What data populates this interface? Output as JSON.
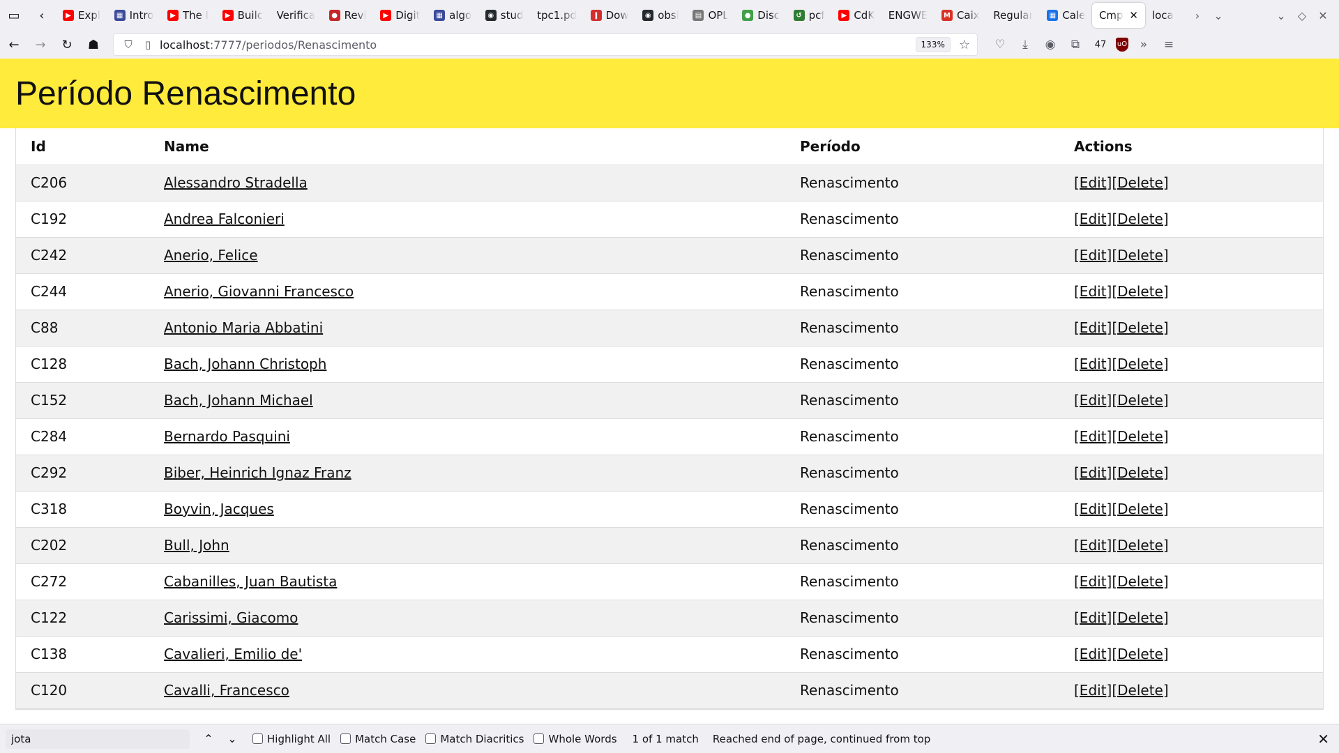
{
  "browser": {
    "tabs": [
      {
        "label": "Expl",
        "fav": "▶",
        "favcolor": "#ff0000"
      },
      {
        "label": "Intro",
        "fav": "▦",
        "favcolor": "#3c4a9a"
      },
      {
        "label": "The I",
        "fav": "▶",
        "favcolor": "#ff0000"
      },
      {
        "label": "Builc",
        "fav": "▶",
        "favcolor": "#ff0000"
      },
      {
        "label": "Verifica",
        "fav": "",
        "favcolor": "transparent"
      },
      {
        "label": "Revi",
        "fav": "●",
        "favcolor": "#c62828"
      },
      {
        "label": "Digit",
        "fav": "▶",
        "favcolor": "#ff0000"
      },
      {
        "label": "algo",
        "fav": "▦",
        "favcolor": "#3c4a9a"
      },
      {
        "label": "stud",
        "fav": "◉",
        "favcolor": "#24292f"
      },
      {
        "label": "tpc1.pd",
        "fav": "",
        "favcolor": "transparent"
      },
      {
        "label": "Dow",
        "fav": "‖",
        "favcolor": "#d32f2f"
      },
      {
        "label": "obsi",
        "fav": "◉",
        "favcolor": "#24292f"
      },
      {
        "label": "OPL",
        "fav": "▤",
        "favcolor": "#777777"
      },
      {
        "label": "Disc",
        "fav": "●",
        "favcolor": "#43a047"
      },
      {
        "label": "pcf",
        "fav": "↺",
        "favcolor": "#2e7d32"
      },
      {
        "label": "CdK",
        "fav": "▶",
        "favcolor": "#ff0000"
      },
      {
        "label": "ENGWE",
        "fav": "",
        "favcolor": "transparent"
      },
      {
        "label": "Caix",
        "fav": "M",
        "favcolor": "#d93025"
      },
      {
        "label": "Regular",
        "fav": "",
        "favcolor": "transparent"
      },
      {
        "label": "Cale",
        "fav": "▦",
        "favcolor": "#1a73e8"
      },
      {
        "label": "Cmpc",
        "fav": "",
        "favcolor": "transparent",
        "active": true
      },
      {
        "label": "loca",
        "fav": "",
        "favcolor": "transparent"
      }
    ],
    "url_host": "localhost",
    "url_path": ":7777/periodos/Renascimento",
    "zoom": "133%",
    "extension_count": "47"
  },
  "page": {
    "title": "Período Renascimento",
    "columns": {
      "id": "Id",
      "name": "Name",
      "periodo": "Período",
      "actions": "Actions"
    },
    "edit_label": "[Edit]",
    "delete_label": "[Delete]",
    "rows": [
      {
        "id": "C206",
        "name": "Alessandro Stradella",
        "periodo": "Renascimento"
      },
      {
        "id": "C192",
        "name": "Andrea Falconieri",
        "periodo": "Renascimento"
      },
      {
        "id": "C242",
        "name": "Anerio, Felice",
        "periodo": "Renascimento"
      },
      {
        "id": "C244",
        "name": "Anerio, Giovanni Francesco",
        "periodo": "Renascimento"
      },
      {
        "id": "C88",
        "name": "Antonio Maria Abbatini",
        "periodo": "Renascimento"
      },
      {
        "id": "C128",
        "name": "Bach, Johann Christoph",
        "periodo": "Renascimento"
      },
      {
        "id": "C152",
        "name": "Bach, Johann Michael",
        "periodo": "Renascimento"
      },
      {
        "id": "C284",
        "name": "Bernardo Pasquini",
        "periodo": "Renascimento"
      },
      {
        "id": "C292",
        "name": "Biber, Heinrich Ignaz Franz",
        "periodo": "Renascimento"
      },
      {
        "id": "C318",
        "name": "Boyvin, Jacques",
        "periodo": "Renascimento"
      },
      {
        "id": "C202",
        "name": "Bull, John",
        "periodo": "Renascimento"
      },
      {
        "id": "C272",
        "name": "Cabanilles, Juan Bautista",
        "periodo": "Renascimento"
      },
      {
        "id": "C122",
        "name": "Carissimi, Giacomo",
        "periodo": "Renascimento"
      },
      {
        "id": "C138",
        "name": "Cavalieri, Emilio de'",
        "periodo": "Renascimento"
      },
      {
        "id": "C120",
        "name": "Cavalli, Francesco",
        "periodo": "Renascimento"
      }
    ]
  },
  "findbar": {
    "query": "jota",
    "highlight_all": "Highlight All",
    "match_case": "Match Case",
    "match_diacritics": "Match Diacritics",
    "whole_words": "Whole Words",
    "match_count": "1 of 1 match",
    "status": "Reached end of page, continued from top"
  },
  "colors": {
    "header_bg": "#ffeb3b",
    "stripe": "#f1f1f1"
  }
}
